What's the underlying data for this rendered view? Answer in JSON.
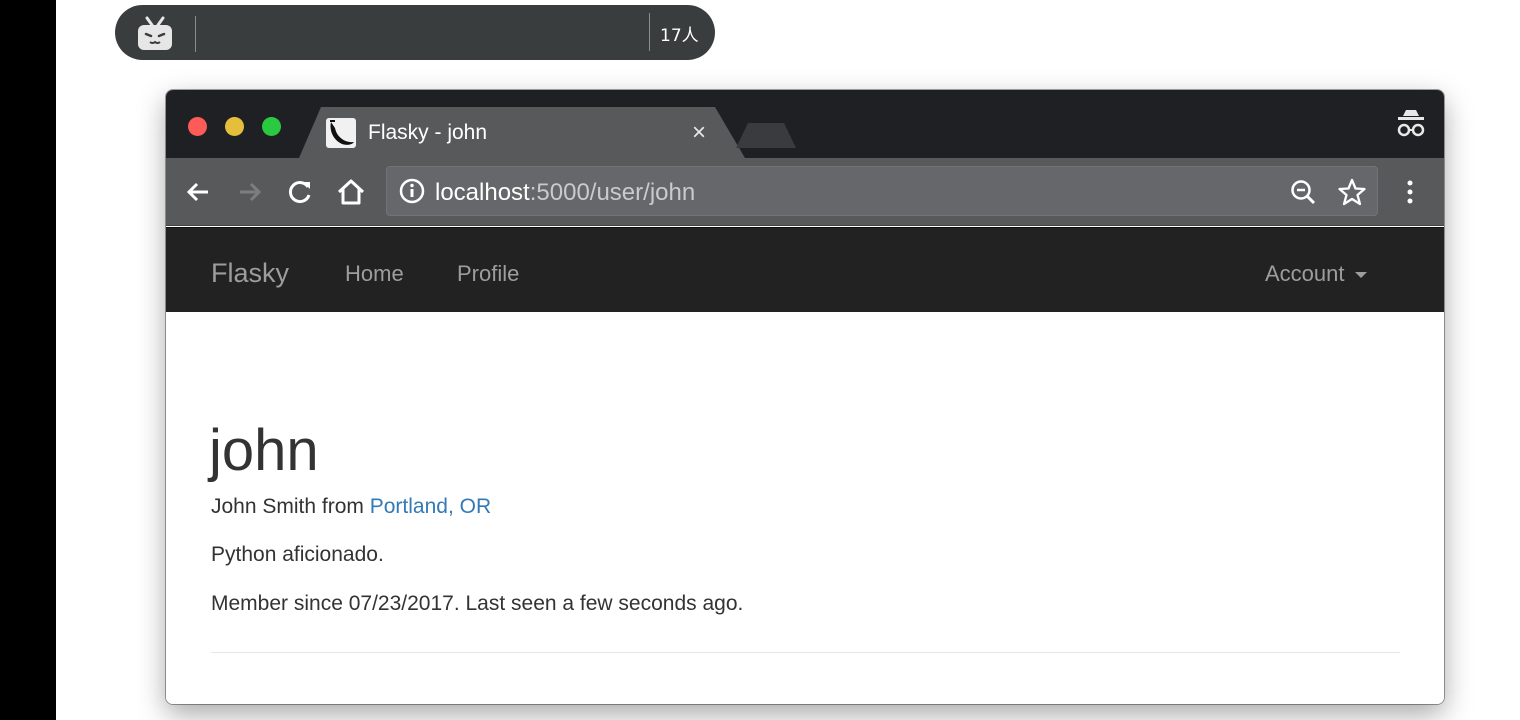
{
  "overlay": {
    "viewer_count": "17人"
  },
  "browser": {
    "tab_title": "Flasky - john",
    "tab_close": "×",
    "url_host": "localhost",
    "url_path": ":5000/user/john"
  },
  "navbar": {
    "brand": "Flasky",
    "home": "Home",
    "profile": "Profile",
    "account": "Account"
  },
  "profile": {
    "username": "john",
    "name_prefix": "John Smith from ",
    "location": "Portland, OR",
    "about": "Python aficionado.",
    "member_info": "Member since 07/23/2017. Last seen a few seconds ago."
  },
  "colors": {
    "navbar_bg": "#222222",
    "link": "#337ab7",
    "close_red": "#fc5b57",
    "minimize_yellow": "#e5bf3c",
    "zoom_green": "#29c940"
  },
  "icons": [
    "bilibili-tv-icon",
    "flask-favicon-icon",
    "incognito-icon",
    "back-arrow-icon",
    "forward-arrow-icon",
    "reload-icon",
    "home-icon",
    "info-icon",
    "zoom-out-icon",
    "star-icon",
    "menu-dots-icon",
    "caret-down-icon"
  ]
}
